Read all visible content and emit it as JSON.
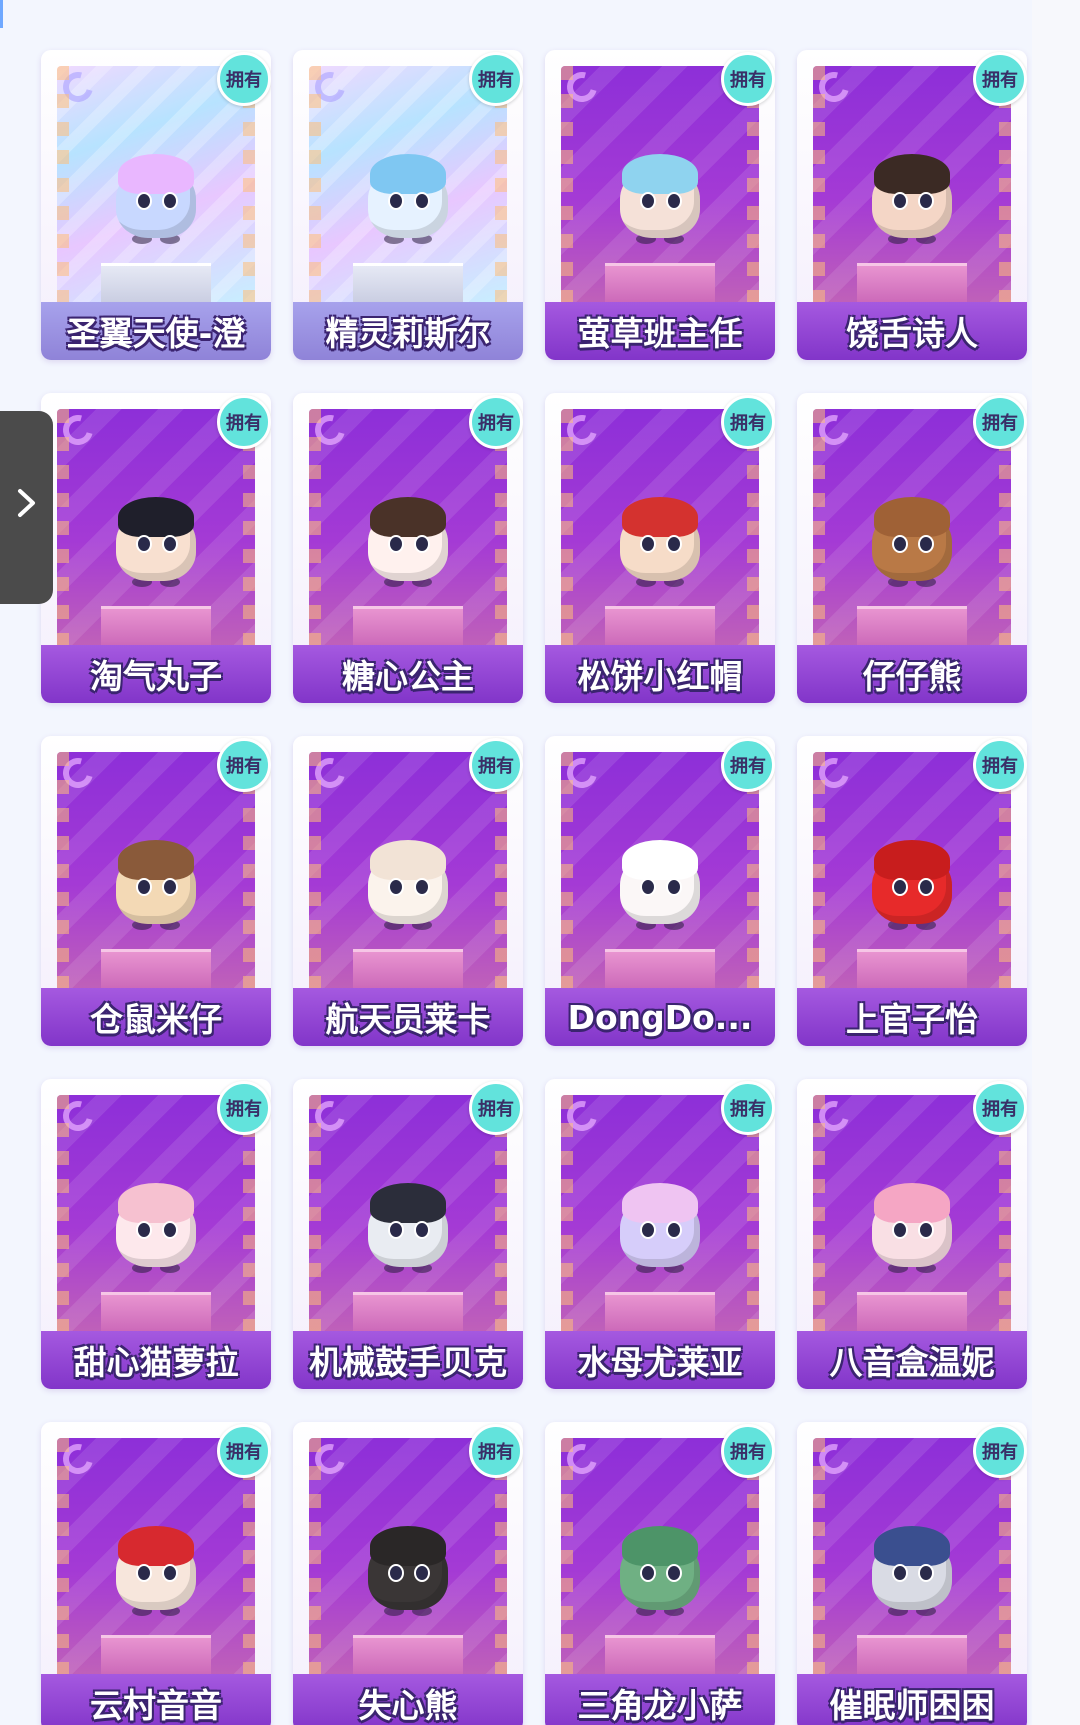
{
  "owned_label": "拥有",
  "side_toggle_icon": "chevron-right-icon",
  "cards": [
    {
      "name": "圣翼天使-澄",
      "style": "holo",
      "body": "#c8d8ff",
      "hair": "#e9b7ff"
    },
    {
      "name": "精灵莉斯尔",
      "style": "holo",
      "body": "#e6f2ff",
      "hair": "#7fc7f2"
    },
    {
      "name": "萤草班主任",
      "style": "purple",
      "body": "#f5e1d8",
      "hair": "#8fd3ef"
    },
    {
      "name": "饶舌诗人",
      "style": "purple",
      "body": "#f4d6c6",
      "hair": "#3b2a24"
    },
    {
      "name": "淘气丸子",
      "style": "purple",
      "body": "#f8e0d0",
      "hair": "#1f1f2b"
    },
    {
      "name": "糖心公主",
      "style": "purple",
      "body": "#fff1ee",
      "hair": "#4a3228"
    },
    {
      "name": "松饼小红帽",
      "style": "purple",
      "body": "#f6dcc8",
      "hair": "#d4322f"
    },
    {
      "name": "仔仔熊",
      "style": "purple",
      "body": "#b97946",
      "hair": "#9f6136"
    },
    {
      "name": "仓鼠米仔",
      "style": "purple",
      "body": "#f3d9b5",
      "hair": "#8a5a3a"
    },
    {
      "name": "航天员莱卡",
      "style": "purple",
      "body": "#fbf3ec",
      "hair": "#f2e3d6"
    },
    {
      "name": "DongDo...",
      "style": "purple",
      "body": "#fbf7f7",
      "hair": "#ffffff"
    },
    {
      "name": "上官子怡",
      "style": "purple",
      "body": "#e72a2a",
      "hair": "#c81d1d"
    },
    {
      "name": "甜心猫萝拉",
      "style": "purple",
      "body": "#fde8ec",
      "hair": "#f6c1d0"
    },
    {
      "name": "机械鼓手贝克",
      "style": "purple",
      "body": "#e9ecf2",
      "hair": "#2b2d3a"
    },
    {
      "name": "水母尤莱亚",
      "style": "purple",
      "body": "#d6cdfa",
      "hair": "#efc4f2"
    },
    {
      "name": "八音盒温妮",
      "style": "purple",
      "body": "#f9dfe4",
      "hair": "#f5a6c4"
    },
    {
      "name": "云村音音",
      "style": "purple",
      "body": "#f7e6dc",
      "hair": "#d7292f"
    },
    {
      "name": "失心熊",
      "style": "purple",
      "body": "#3a3636",
      "hair": "#2a2727"
    },
    {
      "name": "三角龙小萨",
      "style": "purple",
      "body": "#6fb083",
      "hair": "#4d9468"
    },
    {
      "name": "催眠师困困",
      "style": "purple",
      "body": "#d9dbe4",
      "hair": "#3a4f8f"
    }
  ]
}
